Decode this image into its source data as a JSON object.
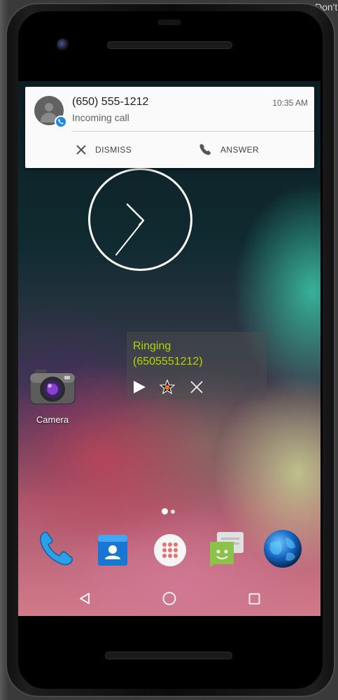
{
  "host": {
    "corner_text": "Don't"
  },
  "notification": {
    "title": "(650) 555-1212",
    "time": "10:35 AM",
    "subtitle": "Incoming call",
    "dismiss_label": "DISMISS",
    "answer_label": "ANSWER"
  },
  "clock": {
    "hour_hand": "11",
    "minute_hand": "35"
  },
  "widget": {
    "status": "Ringing",
    "number": "(6505551212)"
  },
  "home": {
    "camera_label": "Camera",
    "dock": [
      "phone-app-icon",
      "contacts-app-icon",
      "app-drawer-icon",
      "messaging-app-icon",
      "browser-app-icon"
    ]
  },
  "colors": {
    "widget_text": "#b0d400",
    "badge": "#1e88e5",
    "notification_bg": "#fafafa"
  }
}
